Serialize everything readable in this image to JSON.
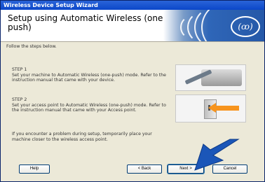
{
  "window": {
    "title": "Wireless Device Setup Wizard"
  },
  "banner": {
    "title": "Setup using Automatic Wireless (one-push)",
    "logo_glyph": "((ꝏ))",
    "logo_icon": "wireless-logo-icon"
  },
  "content": {
    "intro": "Follow the steps below.",
    "step1": {
      "heading": "STEP 1",
      "text": "Set your machine to Automatic Wireless (one-push) mode. Refer to the instruction manual that came with your device."
    },
    "step2": {
      "heading": "STEP 2",
      "text": "Set your access point to Automatic Wireless (one-push) mode. Refer to the instruction manual that came with your Access point."
    },
    "note": "If you encounter a problem during setup, temporarily place your machine closer to the wireless access point."
  },
  "buttons": {
    "help": "Help",
    "back": "< Back",
    "next": "Next >",
    "cancel": "Cancel"
  },
  "colors": {
    "titlebar": "#0b47c9",
    "banner_accent": "#2f66b8",
    "pointer_arrow": "#1b56b8",
    "access_point_arrow": "#f7941d"
  }
}
